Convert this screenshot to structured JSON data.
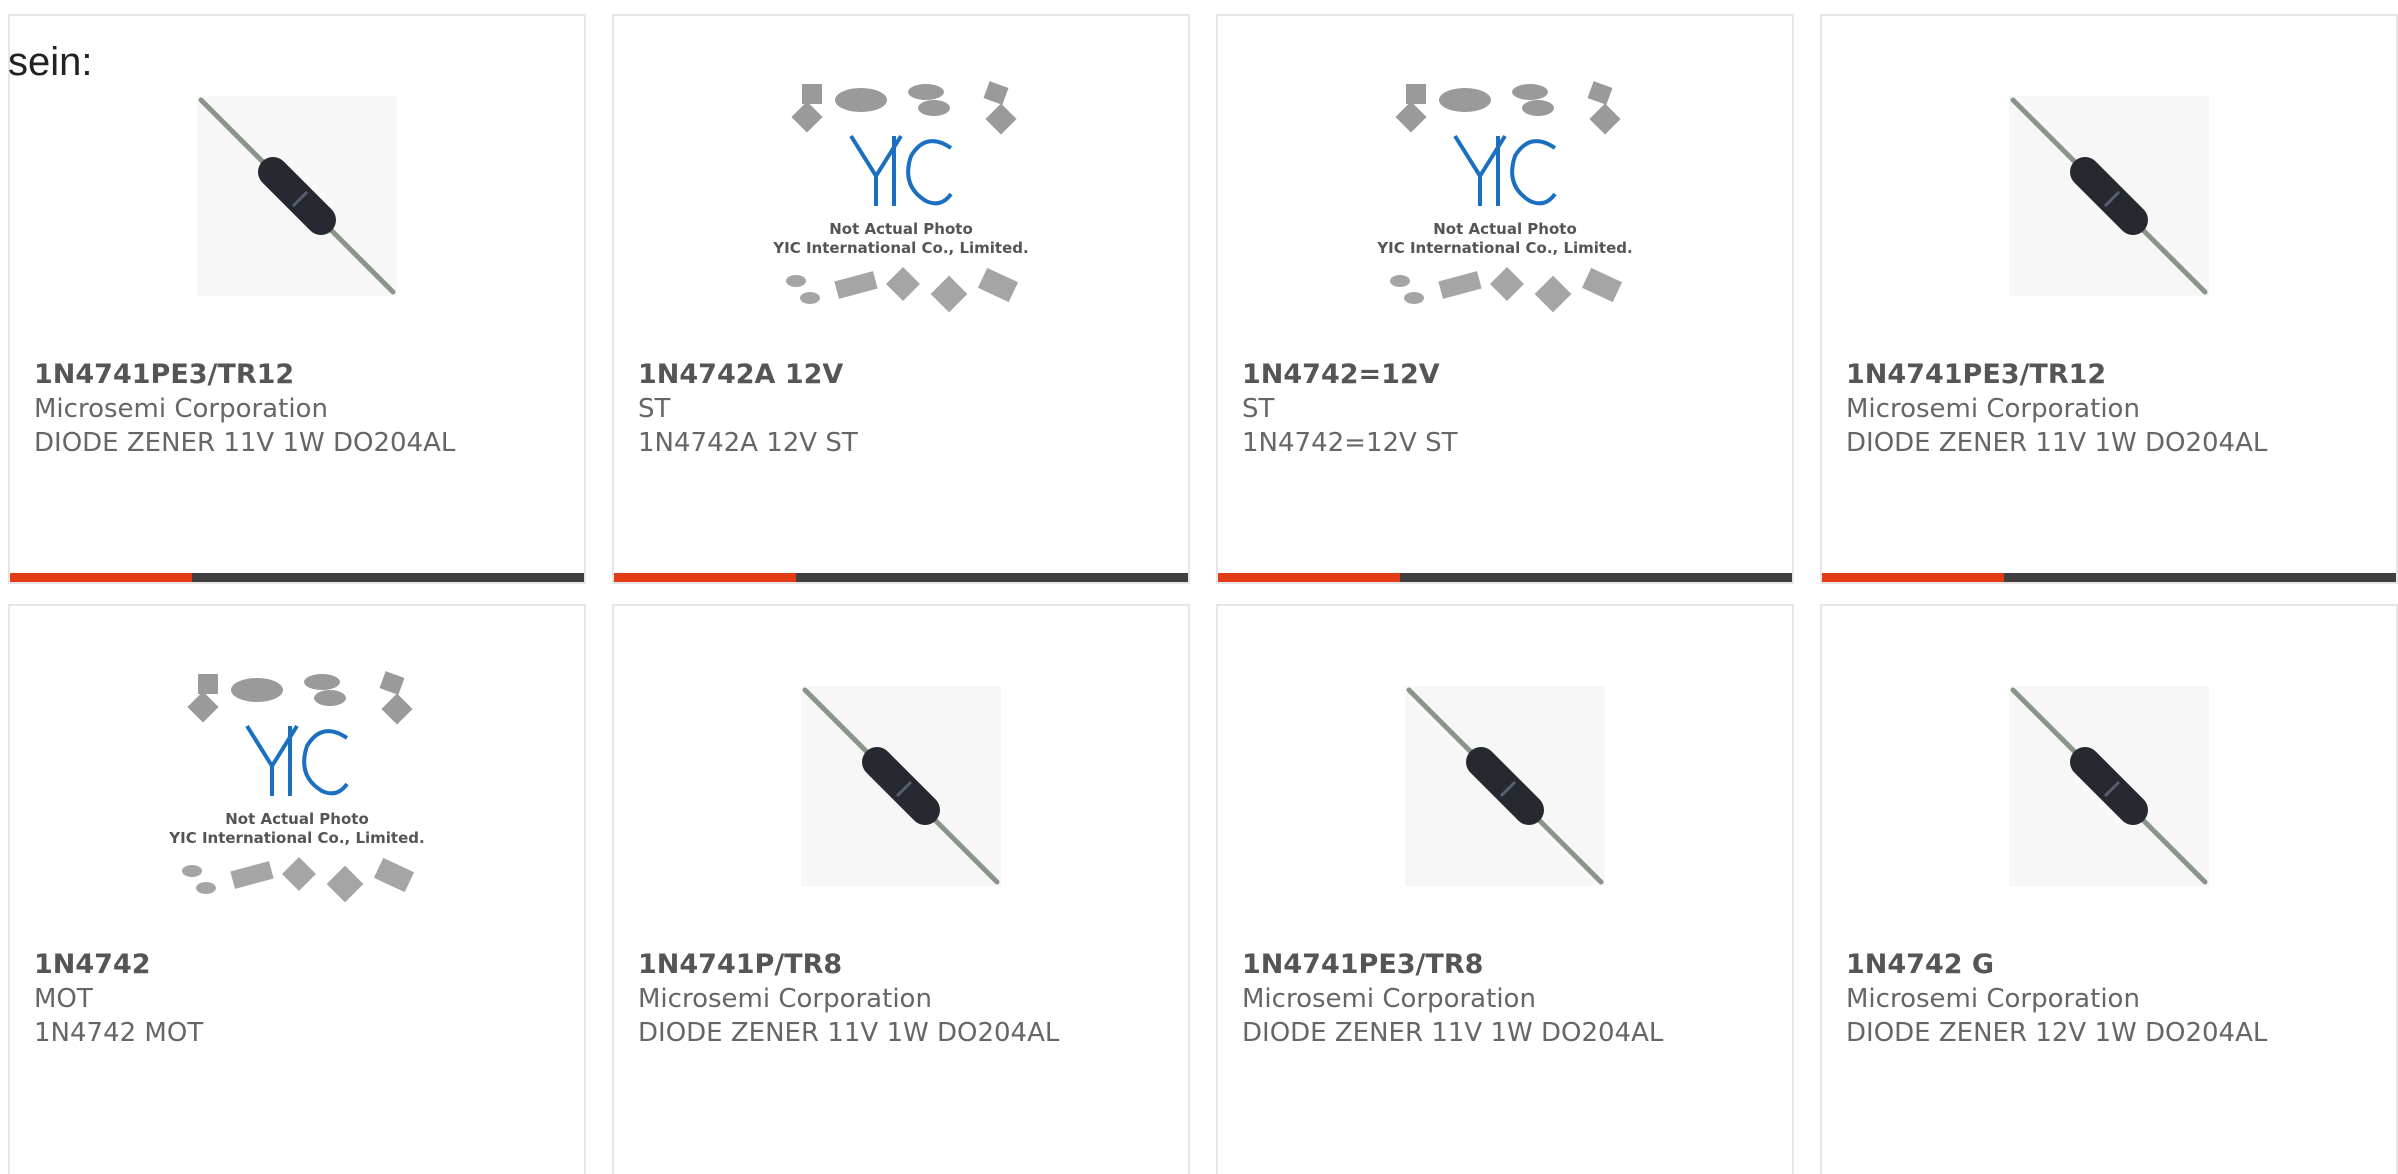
{
  "intro_text": "sein:",
  "colors": {
    "accent_bar": "#e23b16",
    "dark_bar": "#3f3f3f",
    "yic_blue": "#1a6fc0"
  },
  "cards": [
    {
      "part": "1N4741PE3/TR12",
      "maker": "Microsemi Corporation",
      "desc": "DIODE ZENER 11V 1W DO204AL",
      "image": "diode-photo"
    },
    {
      "part": "1N4742A 12V",
      "maker": "ST",
      "desc": "1N4742A 12V ST",
      "image": "placeholder-logo",
      "placeholder_lines": [
        "Not Actual Photo",
        "YIC International Co., Limited."
      ]
    },
    {
      "part": "1N4742=12V",
      "maker": "ST",
      "desc": "1N4742=12V ST",
      "image": "placeholder-logo",
      "placeholder_lines": [
        "Not Actual Photo",
        "YIC International Co., Limited."
      ]
    },
    {
      "part": "1N4741PE3/TR12",
      "maker": "Microsemi Corporation",
      "desc": "DIODE ZENER 11V 1W DO204AL",
      "image": "diode-photo"
    },
    {
      "part": "1N4742",
      "maker": "MOT",
      "desc": "1N4742 MOT",
      "image": "placeholder-logo",
      "placeholder_lines": [
        "Not Actual Photo",
        "YIC International Co., Limited."
      ]
    },
    {
      "part": "1N4741P/TR8",
      "maker": "Microsemi Corporation",
      "desc": "DIODE ZENER 11V 1W DO204AL",
      "image": "diode-photo"
    },
    {
      "part": "1N4741PE3/TR8",
      "maker": "Microsemi Corporation",
      "desc": "DIODE ZENER 11V 1W DO204AL",
      "image": "diode-photo"
    },
    {
      "part": "1N4742 G",
      "maker": "Microsemi Corporation",
      "desc": "DIODE ZENER 12V 1W DO204AL",
      "image": "diode-photo"
    }
  ]
}
